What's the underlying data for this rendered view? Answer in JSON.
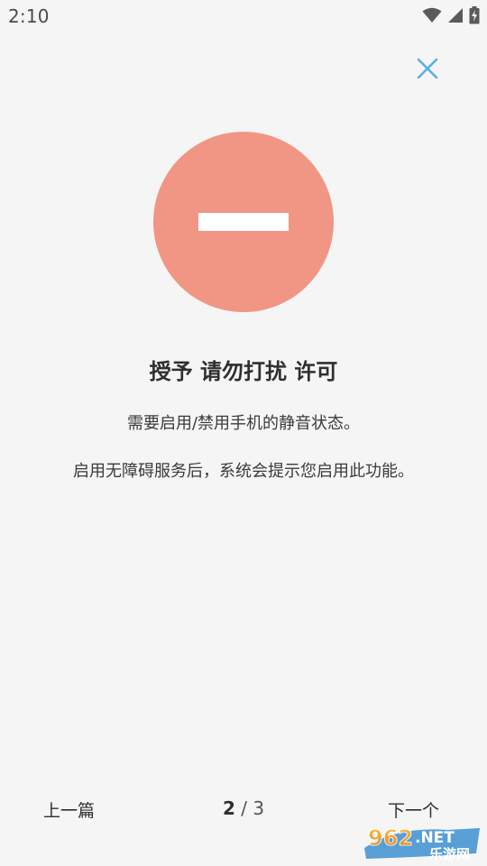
{
  "status_bar": {
    "time": "2:10",
    "icons": [
      "wifi-icon",
      "cell-signal-icon",
      "battery-charging-icon"
    ]
  },
  "close": {
    "icon": "close-icon",
    "color": "#5ab0de"
  },
  "hero": {
    "icon": "do-not-disturb-icon",
    "color": "#f19684"
  },
  "content": {
    "title": "授予 请勿打扰 许可",
    "description_1": "需要启用/禁用手机的静音状态。",
    "description_2": "启用无障碍服务后，系统会提示您启用此功能。"
  },
  "nav": {
    "prev_label": "上一篇",
    "current_page": "2",
    "separator": "/",
    "total_pages": "3",
    "next_label": "下一个"
  },
  "watermark": {
    "text_main": "962.NET",
    "text_sub": "乐游网"
  }
}
